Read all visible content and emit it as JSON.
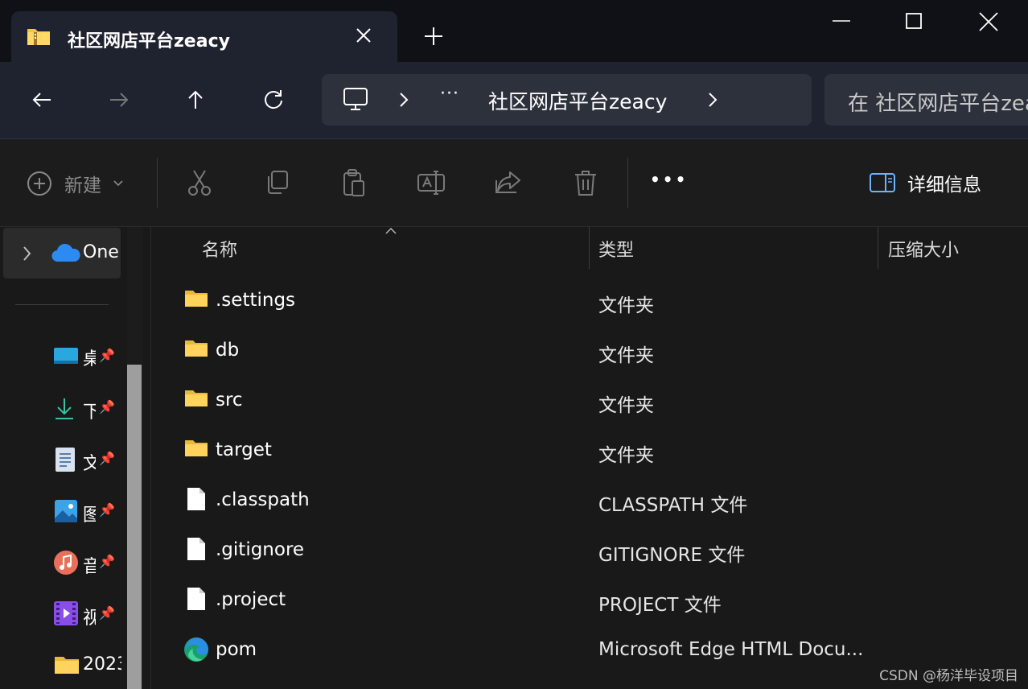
{
  "window": {
    "tab_title": "社区网店平台zeacy"
  },
  "nav": {
    "breadcrumb_ellipsis": "···",
    "current_folder": "社区网店平台zeacy",
    "search_placeholder": "在 社区网店平台zeacy 中搜索"
  },
  "toolbar": {
    "new_label": "新建",
    "more_label": "•••",
    "details_label": "详细信息"
  },
  "sidebar": {
    "onedrive_label": "One",
    "items": [
      {
        "label": "桌",
        "icon": "desktop-icon"
      },
      {
        "label": "下",
        "icon": "download-icon"
      },
      {
        "label": "文",
        "icon": "documents-icon"
      },
      {
        "label": "图",
        "icon": "pictures-icon"
      },
      {
        "label": "音",
        "icon": "music-icon"
      },
      {
        "label": "视",
        "icon": "videos-icon"
      },
      {
        "label": "2023",
        "icon": "folder-icon"
      }
    ]
  },
  "columns": {
    "name": "名称",
    "type": "类型",
    "size": "压缩大小"
  },
  "files": [
    {
      "name": ".settings",
      "type": "文件夹",
      "icon": "folder-icon"
    },
    {
      "name": "db",
      "type": "文件夹",
      "icon": "folder-icon"
    },
    {
      "name": "src",
      "type": "文件夹",
      "icon": "folder-icon"
    },
    {
      "name": "target",
      "type": "文件夹",
      "icon": "folder-icon"
    },
    {
      "name": ".classpath",
      "type": "CLASSPATH 文件",
      "icon": "file-icon"
    },
    {
      "name": ".gitignore",
      "type": "GITIGNORE 文件",
      "icon": "file-icon"
    },
    {
      "name": ".project",
      "type": "PROJECT 文件",
      "icon": "file-icon"
    },
    {
      "name": "pom",
      "type": "Microsoft Edge HTML Docu...",
      "icon": "edge-icon"
    }
  ],
  "watermark": "CSDN @杨洋毕设项目"
}
